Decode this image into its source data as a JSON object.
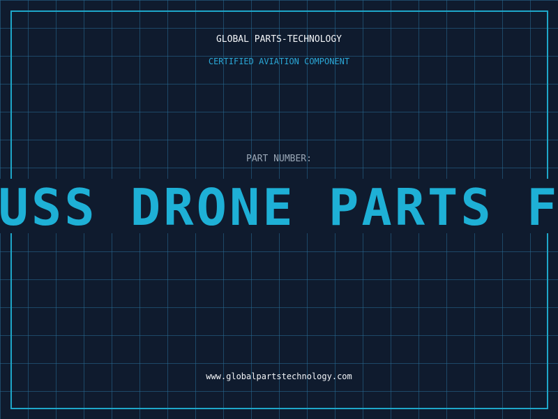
{
  "header": {
    "company": "GLOBAL PARTS-TECHNOLOGY",
    "tagline": "CERTIFIED AVIATION COMPONENT"
  },
  "part": {
    "label": "PART NUMBER:",
    "value": "PAUSS DRONE PARTS FPV"
  },
  "footer": {
    "url": "www.globalpartstechnology.com"
  },
  "colors": {
    "background": "#0f1b2e",
    "grid": "#286e96",
    "frame": "#1ea7c9",
    "accent": "#1eb0d6",
    "text": "#f2f4f7",
    "muted": "#9aa7b6"
  }
}
